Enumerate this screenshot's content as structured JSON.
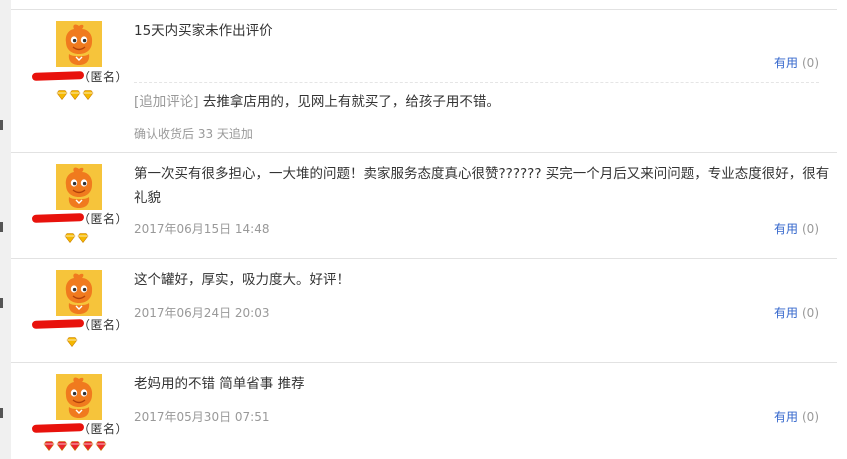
{
  "reviews": [
    {
      "text": "15天内买家未作出评价",
      "anonymous_label": "（匿名）",
      "useful_label": "有用",
      "useful_count": "(0)",
      "badge_count": 3,
      "badge_color": "#f5b800",
      "append": {
        "tag": "[追加评论]",
        "text": "去推拿店用的，见网上有就买了，给孩子用不错。",
        "meta": "确认收货后 33 天追加"
      }
    },
    {
      "text": "第一次买有很多担心，一大堆的问题！卖家服务态度真心很赞?????? 买完一个月后又来问问题，专业态度很好，很有礼貌",
      "date": "2017年06月15日 14:48",
      "anonymous_label": "（匿名）",
      "useful_label": "有用",
      "useful_count": "(0)",
      "badge_count": 2,
      "badge_color": "#f5b800"
    },
    {
      "text": "这个罐好，厚实，吸力度大。好评！",
      "date": "2017年06月24日 20:03",
      "anonymous_label": "（匿名）",
      "useful_label": "有用",
      "useful_count": "(0)",
      "badge_count": 1,
      "badge_color": "#f5b800"
    },
    {
      "text": "老妈用的不错 简单省事 推荐",
      "date": "2017年05月30日 07:51",
      "anonymous_label": "（匿名）",
      "useful_label": "有用",
      "useful_count": "(0)",
      "badge_count": 5,
      "badge_color": "#e8222c"
    }
  ]
}
